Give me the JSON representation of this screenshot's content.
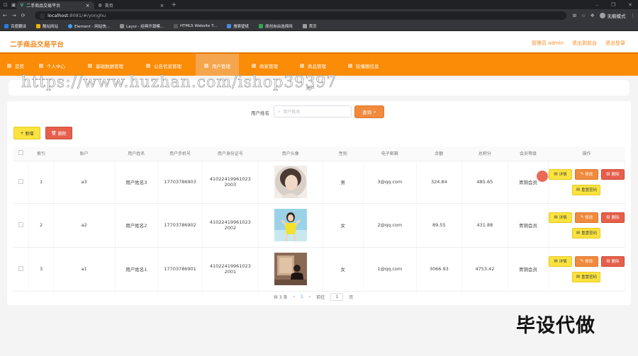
{
  "browser": {
    "tabs": [
      {
        "label": "二手商品交易平台",
        "active": true
      },
      {
        "label": "首页",
        "active": false
      }
    ],
    "url_host": "localhost",
    "url_rest": ":8081/#/yonghu",
    "incognito_label": "无痕模式",
    "bookmarks": [
      "百度翻译",
      "酷站网站",
      "Element - 网站快...",
      "Layui - 经典开源模...",
      "HTML5 Website T...",
      "搜索壁纸",
      "原创自由选择网",
      "首页"
    ]
  },
  "app": {
    "title": "二手商品交易平台",
    "header_links": [
      "管理员 admin",
      "退出到前台",
      "退出登录"
    ],
    "nav": [
      "首页",
      "个人中心",
      "基础数据管理",
      "公告信息管理",
      "用户管理",
      "商家管理",
      "商品管理",
      "轮播图信息"
    ],
    "active_nav": "用户管理"
  },
  "breadcrumb": "用户",
  "watermark": "https://www.huzhan.com/ishop39397",
  "search": {
    "label": "用户姓名",
    "placeholder": "用户姓名",
    "button": "查询"
  },
  "actions": {
    "add": "新增",
    "delete": "删除"
  },
  "table": {
    "headers": [
      "索引",
      "账户",
      "用户姓名",
      "用户手机号",
      "用户身份证号",
      "用户头像",
      "性别",
      "电子邮箱",
      "余额",
      "总积分",
      "会员等级",
      "操作"
    ],
    "rows": [
      {
        "index": "1",
        "account": "a3",
        "name": "用户姓名3",
        "phone": "17703786903",
        "id_line1": "41022419961023",
        "id_line2": "2003",
        "gender": "男",
        "email": "3@qq.com",
        "balance": "324.84",
        "points": "485.65",
        "level": "青铜会员"
      },
      {
        "index": "2",
        "account": "a2",
        "name": "用户姓名2",
        "phone": "17703786902",
        "id_line1": "41022419961023",
        "id_line2": "2002",
        "gender": "女",
        "email": "2@qq.com",
        "balance": "89.55",
        "points": "431.88",
        "level": "青铜会员"
      },
      {
        "index": "3",
        "account": "a1",
        "name": "用户姓名1",
        "phone": "17703786901",
        "id_line1": "41022419961023",
        "id_line2": "2001",
        "gender": "女",
        "email": "1@qq.com",
        "balance": "3066.93",
        "points": "4753.42",
        "level": "青铜会员"
      }
    ],
    "row_ops": {
      "detail": "详情",
      "edit": "修改",
      "remove": "删除",
      "reset": "重置密码"
    }
  },
  "pager": {
    "total": "共 3 条",
    "prev": "‹",
    "current": "1",
    "next": "›",
    "goto": "前往",
    "page_value": "1",
    "page_unit": "页"
  },
  "overlay": "毕设代做",
  "colors": {
    "brand": "#fb8c07",
    "title": "#f08a1e",
    "warn": "#fbe33e",
    "danger": "#e65f4b"
  }
}
